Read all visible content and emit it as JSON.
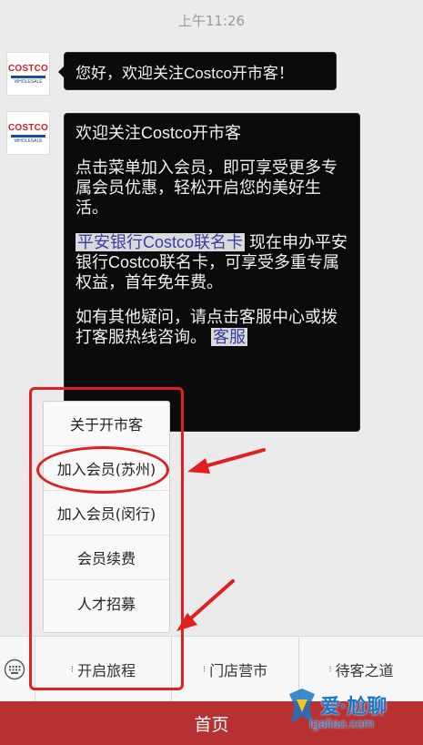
{
  "status_bar": {
    "time": "上午11:26"
  },
  "messages": [
    {
      "sender": "costco-avatar",
      "text": "您好，欢迎关注Costco开市客！"
    },
    {
      "sender": "costco-avatar",
      "paragraphs": [
        "欢迎关注Costco开市客",
        "点击菜单加入会员，即可享受更多专属会员优惠，轻松开启您的美好生活。",
        "现在申办平安银行Costco联名卡，可享受多重专属权益，首年免年费。",
        "如有其他疑问，请点击客服中心或拨打客服热线咨询。"
      ],
      "link_text": "平安银行Costco联名卡",
      "link_text_2": "客服"
    }
  ],
  "avatar": {
    "logo": "COSTCO",
    "sub": "WHOLESALE"
  },
  "popup_menu": {
    "items": [
      "关于开市客",
      "加入会员(苏州)",
      "加入会员(闵行)",
      "会员续费",
      "人才招募"
    ]
  },
  "bottom_menu": {
    "tabs": [
      "开启旅程",
      "门店营市",
      "待客之道"
    ]
  },
  "home_bar": {
    "label": "首页"
  },
  "watermark": {
    "text": "爱·尬聊",
    "url": "igaliao.com"
  },
  "colors": {
    "highlight_red": "#e02020",
    "home_bar": "#b73132",
    "watermark_blue": "#1877c9"
  }
}
